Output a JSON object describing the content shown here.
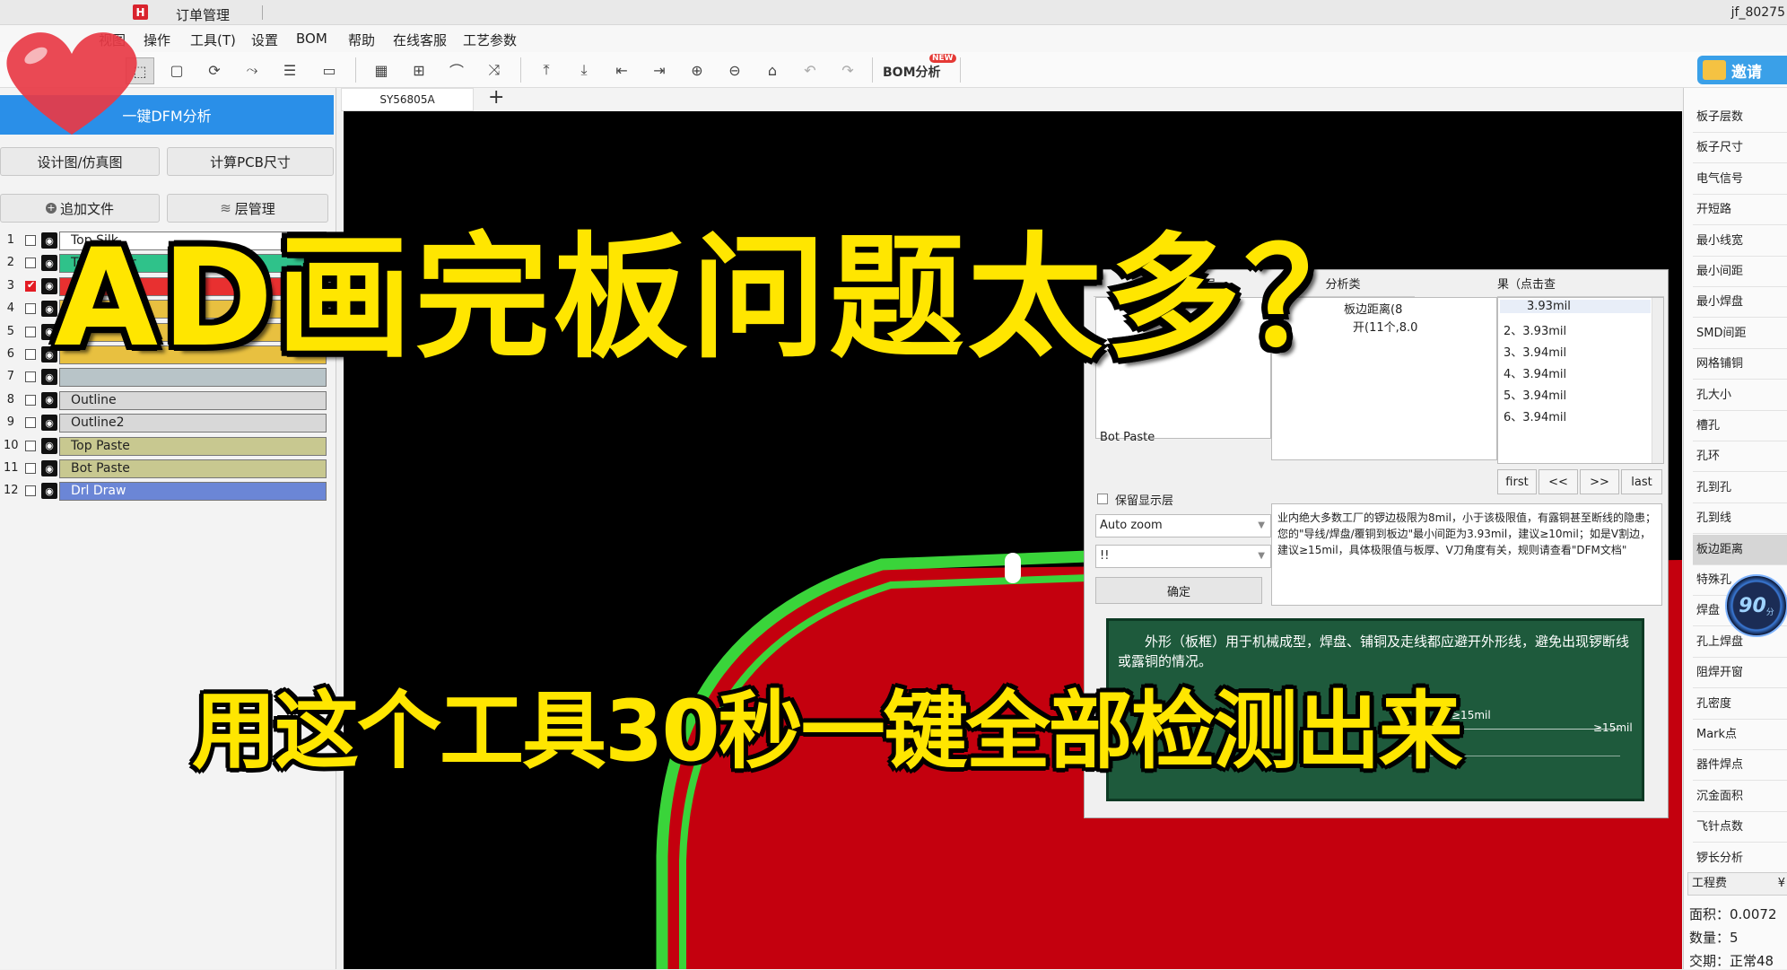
{
  "app": {
    "logo_text": "",
    "tab_title": "订单管理",
    "user": "jf_80275"
  },
  "menu": [
    "视图",
    "操作",
    "工具(T)",
    "设置",
    "BOM",
    "帮助",
    "在线客服",
    "工艺参数"
  ],
  "toolbar": {
    "bom_label": "BOM分析",
    "new_badge": "NEW",
    "invite_label": "邀请"
  },
  "left": {
    "dfm_button": "一键DFM分析",
    "design_button": "设计图/仿真图",
    "calc_button": "计算PCB尺寸",
    "add_file_button": "追加文件",
    "layer_mgmt_button": "层管理",
    "layers": [
      {
        "num": "1",
        "name": "Top Silk",
        "color": "#ffffff",
        "checked": false
      },
      {
        "num": "2",
        "name": "Top Solder",
        "color": "#2fc28a",
        "checked": false
      },
      {
        "num": "3",
        "name": "",
        "color": "#e83030",
        "checked": true
      },
      {
        "num": "4",
        "name": "",
        "color": "#e8c040",
        "checked": false
      },
      {
        "num": "5",
        "name": "",
        "color": "#e8c040",
        "checked": false
      },
      {
        "num": "6",
        "name": "",
        "color": "#e8c040",
        "checked": false
      },
      {
        "num": "7",
        "name": "",
        "color": "#b8c4c8",
        "checked": false
      },
      {
        "num": "8",
        "name": "Outline",
        "color": "#d8d8d8",
        "checked": false
      },
      {
        "num": "9",
        "name": "Outline2",
        "color": "#d8d8d8",
        "checked": false
      },
      {
        "num": "10",
        "name": "Top Paste",
        "color": "#c8c890",
        "checked": false
      },
      {
        "num": "11",
        "name": "Bot Paste",
        "color": "#c8c890",
        "checked": false
      },
      {
        "num": "12",
        "name": "Drl Draw",
        "color": "#6b86d6",
        "checked": false
      }
    ]
  },
  "canvas": {
    "tab_label": "SY56805A",
    "add_tab": "+"
  },
  "dfm": {
    "col_layer": "层",
    "col_analysis": "分析类",
    "col_result": "果（点击查",
    "analysis_item_1": "板边距离(8",
    "analysis_item_2": "开(11个,8.0",
    "layer_item": "Bot Paste",
    "results": [
      "3.93mil",
      "2、3.93mil",
      "3、3.94mil",
      "4、3.94mil",
      "5、3.94mil",
      "6、3.94mil"
    ],
    "keep_layer_label": "保留显示层",
    "zoom_select": "Auto zoom",
    "second_select": "!!",
    "confirm_button": "确定",
    "nav": [
      "first",
      "<<",
      ">>",
      "last"
    ],
    "description": "业内绝大多数工厂的锣边极限为8mil，小于该极限值，有露铜甚至断线的隐患；您的\"导线/焊盘/覆铜到板边\"最小间距为3.93mil，建议≥10mil；如是V割边，建议≥15mil，具体极限值与板厚、V刀角度有关，规则请查看\"DFM文档\"",
    "hint": "外形（板框）用于机械成型，焊盘、铺铜及走线都应避开外形线，避免出现锣断线或露铜的情况。",
    "hint_dim_1": "≥15mil",
    "hint_dim_2": "≥15mil"
  },
  "right": {
    "items": [
      "板子层数",
      "板子尺寸",
      "电气信号",
      "开短路",
      "最小线宽",
      "最小间距",
      "最小焊盘",
      "SMD间距",
      "网格铺铜",
      "孔大小",
      "槽孔",
      "孔环",
      "孔到孔",
      "孔到线",
      "板边距离",
      "特殊孔",
      "焊盘",
      "孔上焊盘",
      "阻焊开窗",
      "孔密度",
      "Mark点",
      "器件焊点",
      "沉金面积",
      "飞针点数",
      "锣长分析"
    ],
    "selected_index": 14,
    "score": "90",
    "score_unit": "分",
    "cost_label": "工程费",
    "cost_value": "¥",
    "area": "面积：0.0072",
    "qty": "数量：5",
    "delivery": "交期：正常48"
  },
  "overlay": {
    "headline": "AD画完板问题太多？",
    "subline": "用这个工具30秒一键全部检测出来"
  },
  "colors": {
    "accent_blue": "#2a8fe8",
    "board_red": "#c4000e",
    "outline_green": "#3ad43a",
    "text_yellow": "#ffe600"
  }
}
